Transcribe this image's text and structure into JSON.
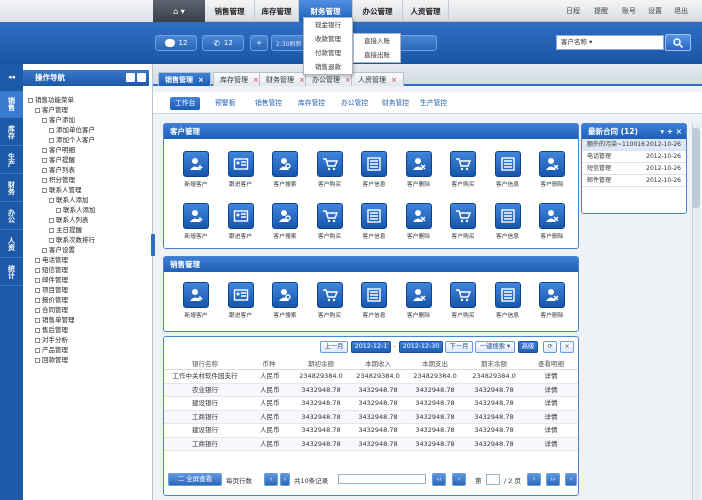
{
  "topbar": {
    "home_label": "⌂ ▾",
    "nav": [
      "销售管理",
      "库存管理",
      "财务管理",
      "办公管理",
      "人资管理"
    ],
    "active_nav": "财务管理",
    "links": [
      "日程",
      "提醒",
      "账号",
      "设置",
      "退出"
    ]
  },
  "dropdown": {
    "items": [
      "现金银行",
      "收款管理",
      "付款管理",
      "销售退款"
    ],
    "sub_items": [
      "直接入账",
      "直接出账"
    ]
  },
  "bar2": {
    "msg_count": "12",
    "call_count": "12",
    "add_label": "+",
    "input_text": "2:30刷新",
    "search_placeholder": "客户名称",
    "search_dropdown": "▾"
  },
  "rail": {
    "toggle": "◂◂",
    "items": [
      "销售",
      "库存",
      "生产",
      "财务",
      "办公",
      "人资",
      "统计"
    ],
    "active": "销售"
  },
  "sidebar": {
    "title": "操作导航",
    "tree": [
      {
        "label": "销售功能菜单",
        "level": 0
      },
      {
        "label": "客户管理",
        "level": 1
      },
      {
        "label": "客户添加",
        "level": 2
      },
      {
        "label": "添加单位客户",
        "level": 3
      },
      {
        "label": "添加个人客户",
        "level": 3
      },
      {
        "label": "客户明细",
        "level": 2
      },
      {
        "label": "客户提醒",
        "level": 2
      },
      {
        "label": "客户列表",
        "level": 2
      },
      {
        "label": "积分管理",
        "level": 2
      },
      {
        "label": "联系人管理",
        "level": 2
      },
      {
        "label": "联系人添加",
        "level": 3
      },
      {
        "label": "联系人添加",
        "level": 4
      },
      {
        "label": "联系人列表",
        "level": 3
      },
      {
        "label": "主日提醒",
        "level": 3
      },
      {
        "label": "联系次数排行",
        "level": 3
      },
      {
        "label": "客户设置",
        "level": 2
      },
      {
        "label": "电话管理",
        "level": 1
      },
      {
        "label": "短信管理",
        "level": 1
      },
      {
        "label": "邮件管理",
        "level": 1
      },
      {
        "label": "项目管理",
        "level": 1
      },
      {
        "label": "报价管理",
        "level": 1
      },
      {
        "label": "合同管理",
        "level": 1
      },
      {
        "label": "销售单管理",
        "level": 1
      },
      {
        "label": "售后管理",
        "level": 1
      },
      {
        "label": "对手分析",
        "level": 1
      },
      {
        "label": "产品管理",
        "level": 1
      },
      {
        "label": "回款管理",
        "level": 1
      }
    ]
  },
  "tabs": [
    {
      "label": "销售管理",
      "active": true
    },
    {
      "label": "库存管理",
      "active": false
    },
    {
      "label": "财务管理",
      "active": false
    },
    {
      "label": "办公管理",
      "active": false
    },
    {
      "label": "人资管理",
      "active": false
    }
  ],
  "tab_close": "×",
  "subtabs": [
    "工作台",
    "预警板",
    "销售管控",
    "库存管控",
    "办公管控",
    "财务管控",
    "生产管控"
  ],
  "panel_customer": {
    "title": "客户管理",
    "row1": [
      "新增客户",
      "跟进客户",
      "客户搜索",
      "客户购买",
      "客户信息",
      "客户删除",
      "客户购买",
      "客户信息",
      "客户删除"
    ],
    "row2": [
      "新增客户",
      "跟进客户",
      "客户搜索",
      "客户购买",
      "客户信息",
      "客户删除",
      "客户购买",
      "客户信息",
      "客户删除"
    ]
  },
  "panel_sales": {
    "title": "销售管理",
    "row1": [
      "新增客户",
      "跟进客户",
      "客户搜索",
      "客户购买",
      "客户信息",
      "客户删除",
      "客户购买",
      "客户信息",
      "客户删除"
    ]
  },
  "contracts": {
    "title": "最新合同 (12)",
    "header_btns": [
      "▾",
      "+",
      "×"
    ],
    "rows": [
      {
        "name": "额外的污染~110016",
        "date": "2012-10-26"
      },
      {
        "name": "电话管理",
        "date": "2012-10-26"
      },
      {
        "name": "短信管理",
        "date": "2012-10-26"
      },
      {
        "name": "邮件管理",
        "date": "2012-10-26"
      }
    ]
  },
  "table": {
    "controls": {
      "prev": "上一月",
      "start": "2012-12-1",
      "end": "2012-12-30",
      "next": "下一月",
      "search": "一键搜索 ▾",
      "advanced": "高级",
      "refresh": "⟳",
      "close": "×"
    },
    "headers": [
      "银行名称",
      "币种",
      "期初余额",
      "本期收入",
      "本期支出",
      "期末余额",
      "查看明细"
    ],
    "rows": [
      [
        "工作中关村软件园支行",
        "人民币",
        "234829384.0",
        "234829384.0",
        "234829384.0",
        "234829384.0",
        "详情"
      ],
      [
        "农业银行",
        "人民币",
        "3432948.78",
        "3432948.78",
        "3432948.78",
        "3432948.78",
        "详情"
      ],
      [
        "建设银行",
        "人民币",
        "3432948.78",
        "3432948.78",
        "3432948.78",
        "3432948.78",
        "详情"
      ],
      [
        "工商银行",
        "人民币",
        "3432948.78",
        "3432948.78",
        "3432948.78",
        "3432948.78",
        "详情"
      ],
      [
        "建设银行",
        "人民币",
        "3432948.78",
        "3432948.78",
        "3432948.78",
        "3432948.78",
        "详情"
      ],
      [
        "工商银行",
        "人民币",
        "3432948.78",
        "3432948.78",
        "3432948.78",
        "3432948.78",
        "详情"
      ]
    ],
    "footer": {
      "view_all": "二 全屏查看",
      "rows_per_page_label": "每页行数",
      "rows_per_page": "‹",
      "total": "共10条记录",
      "page_label": "第",
      "page_of": "/ 2 页",
      "first": "‹‹",
      "prev": "‹",
      "next": "›",
      "last": "››",
      "go": "›"
    }
  }
}
